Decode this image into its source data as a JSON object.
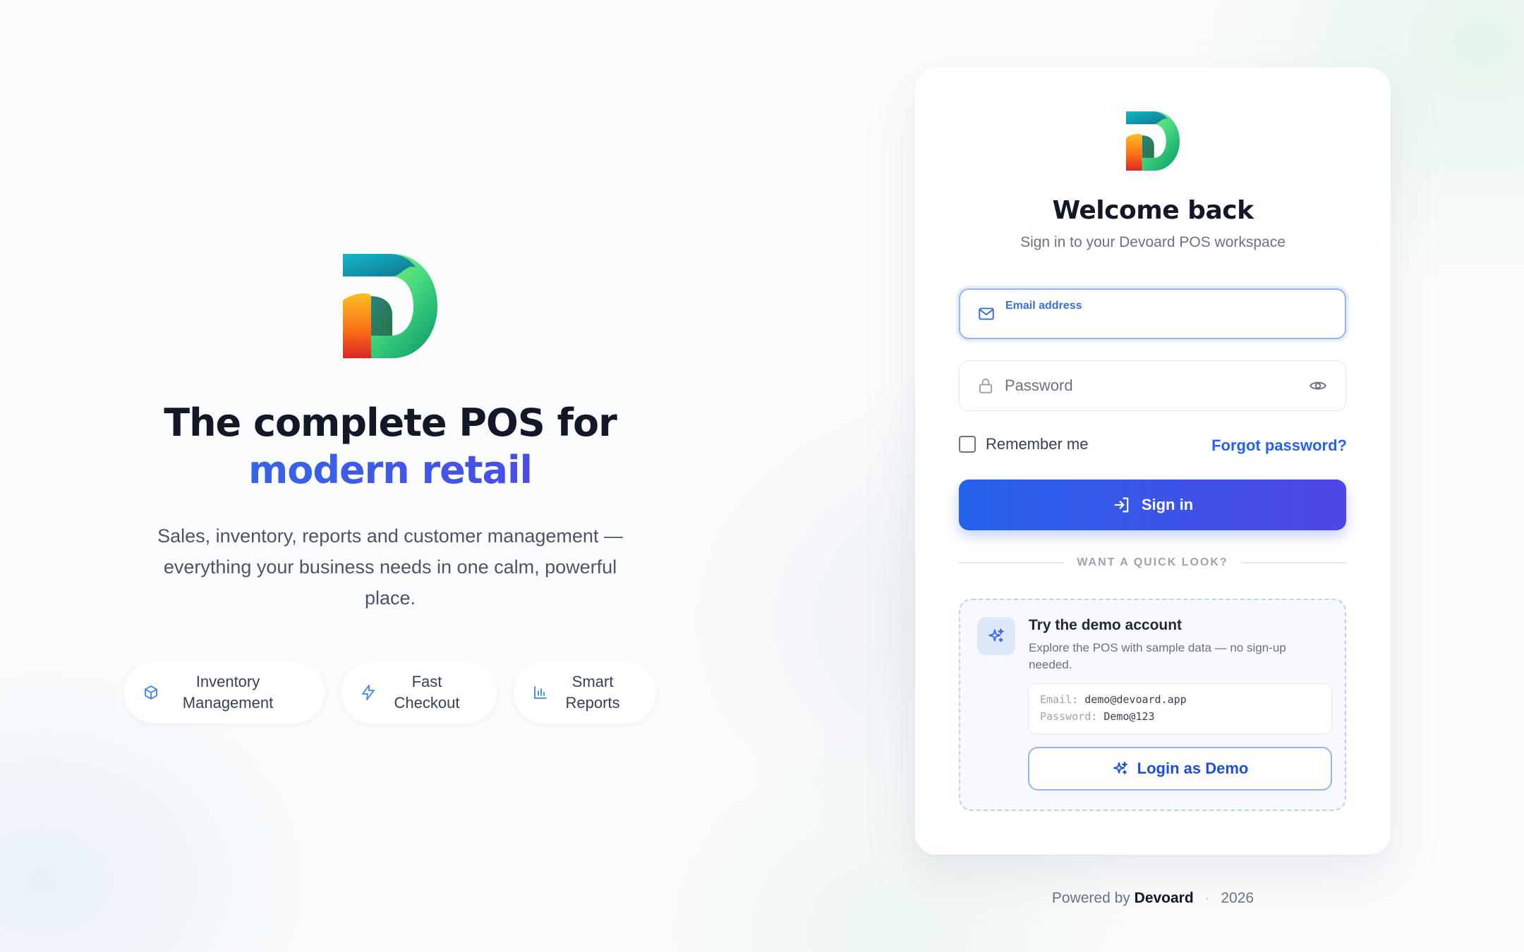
{
  "hero": {
    "title_line1": "The complete POS for",
    "title_line2": "modern retail",
    "subtitle": "Sales, inventory, reports and customer management — everything your business needs in one calm, powerful place.",
    "features": [
      {
        "icon": "box-icon",
        "label": "Inventory Management"
      },
      {
        "icon": "lightning-icon",
        "label": "Fast Checkout"
      },
      {
        "icon": "bar-chart-icon",
        "label": "Smart Reports"
      }
    ]
  },
  "login": {
    "title": "Welcome back",
    "subtitle": "Sign in to your Devoard POS workspace",
    "email": {
      "label": "Email address",
      "value": "",
      "placeholder": ""
    },
    "password": {
      "placeholder": "Password",
      "value": ""
    },
    "remember_label": "Remember me",
    "remember_checked": false,
    "forgot_label": "Forgot password?",
    "signin_label": "Sign in",
    "divider": "WANT A QUICK LOOK?",
    "demo": {
      "title": "Try the demo account",
      "description": "Explore the POS with sample data — no sign-up needed.",
      "email_key": "Email:",
      "email_value": "demo@devoard.app",
      "password_key": "Password:",
      "password_value": "Demo@123",
      "button_label": "Login as Demo"
    }
  },
  "footer": {
    "prefix": "Powered by",
    "brand": "Devoard",
    "separator": "·",
    "year": "2026"
  },
  "colors": {
    "accent_start": "#2563eb",
    "accent_end": "#4f46e5",
    "title_text": "#111827"
  }
}
